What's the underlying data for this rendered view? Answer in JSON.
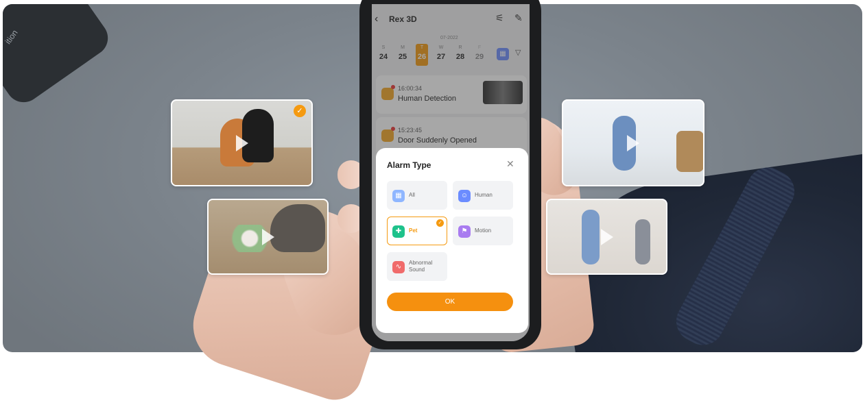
{
  "app": {
    "title": "Rex 3D",
    "month": "07-2022"
  },
  "calendar": [
    {
      "weekday": "S",
      "date": "24",
      "selected": false
    },
    {
      "weekday": "M",
      "date": "25",
      "selected": false
    },
    {
      "weekday": "T",
      "date": "26",
      "selected": true
    },
    {
      "weekday": "W",
      "date": "27",
      "selected": false
    },
    {
      "weekday": "R",
      "date": "28",
      "selected": false
    },
    {
      "weekday": "F",
      "date": "29",
      "selected": false
    }
  ],
  "events": [
    {
      "time": "16:00:34",
      "label": "Human Detection"
    },
    {
      "time": "15:23:45",
      "label": "Door Suddenly Opened"
    }
  ],
  "modal": {
    "title": "Alarm Type",
    "close_icon": "close-icon",
    "options": [
      {
        "label": "All",
        "icon": "grid-icon",
        "color": "#8fb6ff",
        "selected": false
      },
      {
        "label": "Human",
        "icon": "person-icon",
        "color": "#6b8cff",
        "selected": false
      },
      {
        "label": "Pet",
        "icon": "pet-icon",
        "color": "#1ec28b",
        "selected": true
      },
      {
        "label": "Motion",
        "icon": "running-icon",
        "color": "#a97cf0",
        "selected": false
      },
      {
        "label": "Abnormal Sound",
        "icon": "sound-wave-icon",
        "color": "#f06b6b",
        "selected": false
      }
    ],
    "ok_label": "OK"
  },
  "colors": {
    "accent": "#f59a10",
    "ok_button": "#f5900f"
  },
  "corner_device_text": "ition"
}
